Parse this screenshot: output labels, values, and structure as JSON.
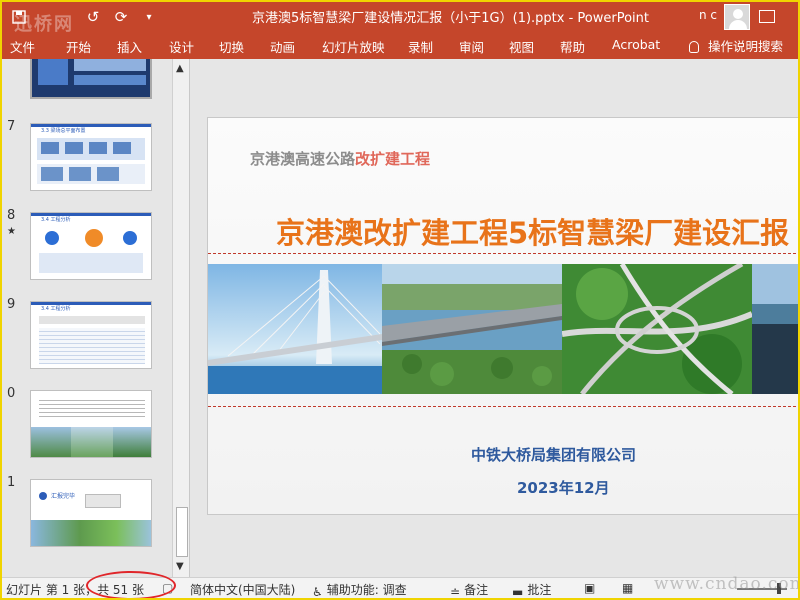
{
  "app": {
    "window_title": "京港澳5标智慧梁厂建设情况汇报（小于1G）(1).pptx  -  PowerPoint",
    "user_initials": "n c",
    "watermark_logo": "迅桥网"
  },
  "ribbon": {
    "tabs": [
      "文件",
      "开始",
      "插入",
      "设计",
      "切换",
      "动画",
      "幻灯片放映",
      "录制",
      "审阅",
      "视图",
      "帮助",
      "Acrobat"
    ],
    "tell_me": "操作说明搜索"
  },
  "thumbnails": [
    {
      "number": "",
      "title": ""
    },
    {
      "number": "7",
      "title": "3.3 梁场总平面布置",
      "starred": false
    },
    {
      "number": "8",
      "title": "3.4 工程分析",
      "starred": true
    },
    {
      "number": "9",
      "title": "3.4 工程分析",
      "starred": false
    },
    {
      "number": "0",
      "title": "",
      "starred": false
    },
    {
      "number": "1",
      "title": "汇报完毕",
      "starred": false
    }
  ],
  "slide": {
    "subtitle_gray": "京港澳高速公路",
    "subtitle_red": "改扩建工程",
    "title": "京港澳改扩建工程5标智慧梁厂建设汇报",
    "company": "中铁大桥局集团有限公司",
    "date": "2023年12月"
  },
  "statusbar": {
    "slide_info": "幻灯片 第 1 张，共 51 张",
    "language": "简体中文(中国大陆)",
    "accessibility": "辅助功能: 调查",
    "notes": "备注",
    "comments": "批注",
    "site_watermark": "www.cndao.com"
  },
  "colors": {
    "ribbon": "#c5462b",
    "title_orange": "#e8731a",
    "company_blue": "#2f5a9e",
    "annotation_red": "#e0262a"
  }
}
